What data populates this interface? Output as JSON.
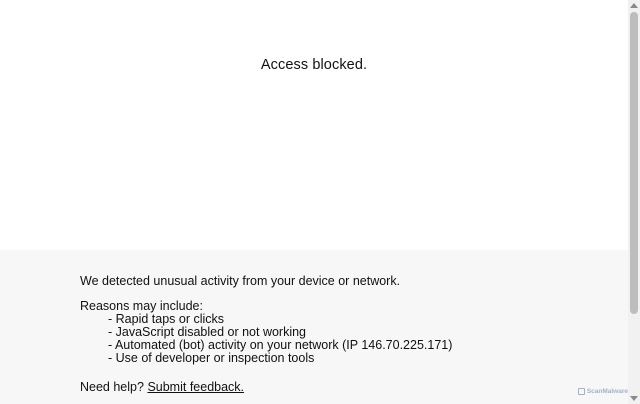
{
  "headline": "Access blocked.",
  "message": "We detected unusual activity from your device or network.",
  "reasons": {
    "heading": "Reasons may include:",
    "items": [
      "- Rapid taps or clicks",
      "- JavaScript disabled or not working",
      "- Automated (bot) activity on your network (IP 146.70.225.171)",
      "- Use of developer or inspection tools"
    ]
  },
  "help": {
    "prefix": "Need help?",
    "link_label": "Submit feedback."
  },
  "brand": {
    "logo_text": "ScanMalware",
    "color": "#9fb3c8"
  },
  "colors": {
    "bottom_panel": "#f7f7f7",
    "text": "#111111"
  }
}
